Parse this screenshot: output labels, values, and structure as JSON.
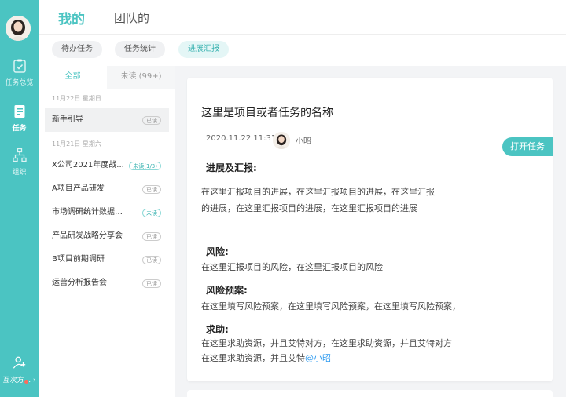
{
  "nav": {
    "items": [
      {
        "label": "任务总览"
      },
      {
        "label": "任务"
      },
      {
        "label": "组织"
      }
    ],
    "bottom_label": "互次方..."
  },
  "header": {
    "tabs": [
      {
        "label": "我的"
      },
      {
        "label": "团队的"
      }
    ]
  },
  "subtabs": [
    {
      "label": "待办任务"
    },
    {
      "label": "任务统计"
    },
    {
      "label": "进展汇报"
    }
  ],
  "list": {
    "tabs": [
      {
        "label": "全部"
      },
      {
        "label": "未读 (99+)"
      }
    ],
    "groups": [
      {
        "date": "11月22日 星期日",
        "items": [
          {
            "title": "新手引导",
            "badge": "已读"
          }
        ]
      },
      {
        "date": "11月21日 星期六",
        "items": [
          {
            "title": "X公司2021年度战...",
            "badge": "未读(1/3)"
          },
          {
            "title": "A项目产品研发",
            "badge": "已读"
          },
          {
            "title": "市场调研统计数据分析...",
            "badge": "未读"
          },
          {
            "title": "产品研发战略分享会",
            "badge": "已读"
          },
          {
            "title": "B项目前期调研",
            "badge": "已读"
          },
          {
            "title": "运营分析报告会",
            "badge": "已读"
          }
        ]
      }
    ]
  },
  "detail": {
    "title": "这里是项目或者任务的名称",
    "datetime": "2020.11.22 11:31",
    "author": "小昭",
    "open_button": "打开任务",
    "progress_heading": "进展及汇报:",
    "progress_line1": "在这里汇报项目的进展，在这里汇报项目的进展，在这里汇报",
    "progress_line2": "的进展，在这里汇报项目的进展，在这里汇报项目的进展",
    "risk_heading": "风险:",
    "risk_text": "在这里汇报项目的风险，在这里汇报项目的风险",
    "plan_heading": "风险预案:",
    "plan_text": "在这里填写风险预案，在这里填写风险预案，在这里填写风险预案，",
    "help_heading": "求助:",
    "help_line1": "在这里求助资源，并且艾特对方，在这里求助资源，并且艾特对方",
    "help_line2": "在这里求助资源，并且艾特",
    "help_mention": "@小昭"
  },
  "colors": {
    "accent": "#4bc4c2",
    "mention": "#2f9bf0",
    "notification_dot": "#ff6b5b"
  }
}
